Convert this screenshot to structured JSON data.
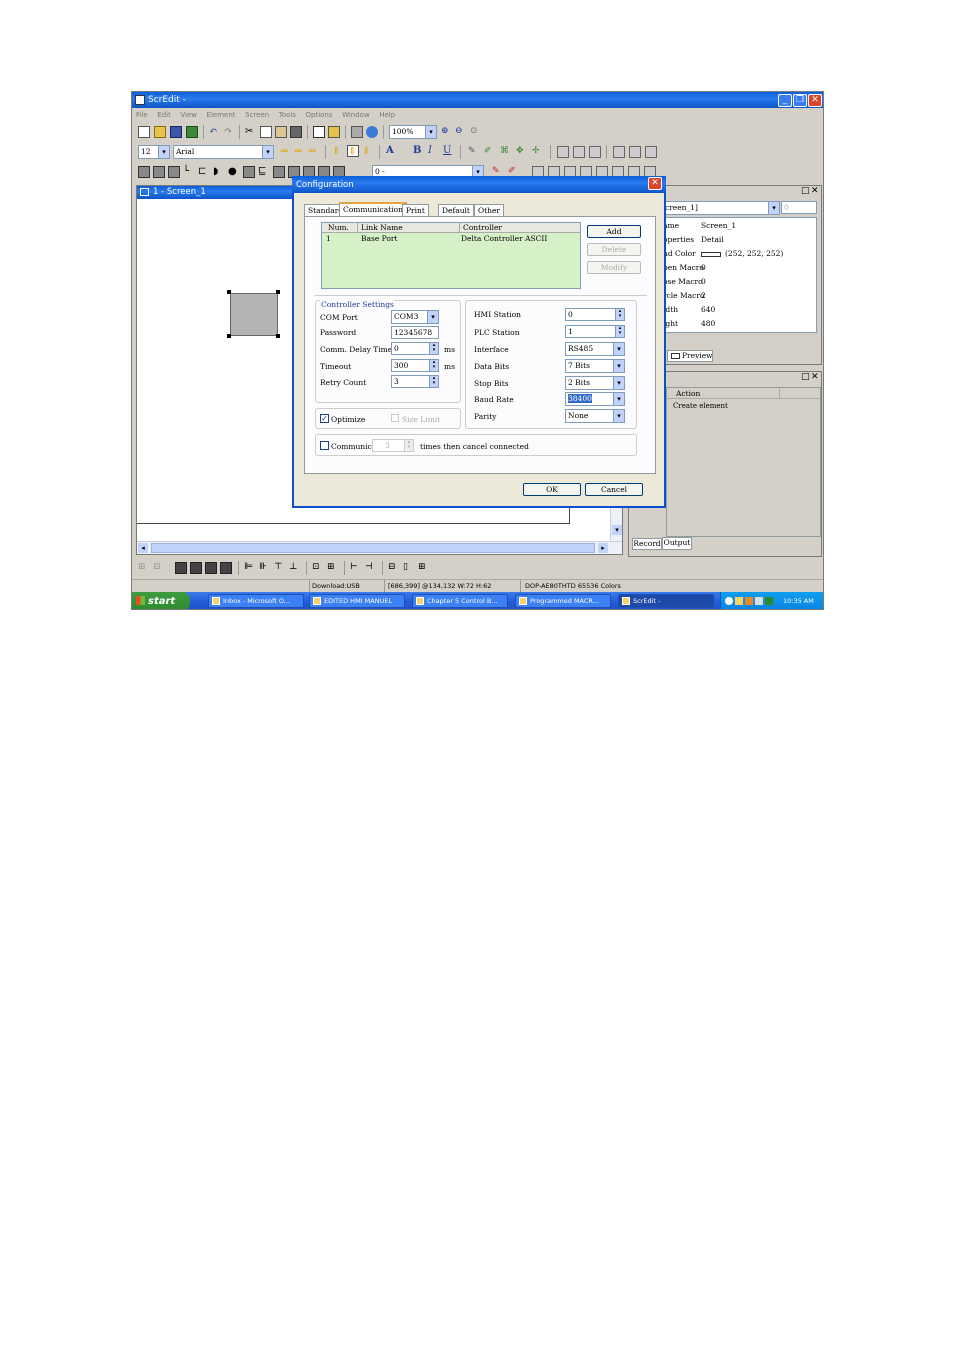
{
  "window": {
    "title": "ScrEdit -"
  },
  "menu": [
    "File",
    "Edit",
    "View",
    "Element",
    "Screen",
    "Tools",
    "Options",
    "Window",
    "Help"
  ],
  "toolbar": {
    "zoom": "100%",
    "font_size": "12",
    "font_name": "Arial",
    "layer": "0 -"
  },
  "screen_panel": {
    "title": "1 - Screen_1"
  },
  "properties_panel": {
    "selector": "creen_1]",
    "rows": [
      {
        "label": "ame",
        "value": "Screen_1"
      },
      {
        "label": "operties",
        "value": "Detail"
      },
      {
        "label": "nd Color",
        "value": "(252, 252, 252)"
      },
      {
        "label": "pen Macro",
        "value": "0"
      },
      {
        "label": "ose Macro",
        "value": "0"
      },
      {
        "label": "rcle Macro",
        "value": "2"
      },
      {
        "label": "idth",
        "value": "640"
      },
      {
        "label": "ight",
        "value": "480"
      }
    ],
    "preview_tab": "Preview"
  },
  "output_panel": {
    "col_action": "Action",
    "row1": "Create element",
    "tabs": [
      "Record",
      "Output"
    ]
  },
  "dialog": {
    "title": "Configuration",
    "tabs": [
      "Standard",
      "Communication",
      "Print",
      "Default",
      "Other"
    ],
    "link_table": {
      "headers": [
        "Num.",
        "Link Name",
        "Controller"
      ],
      "rows": [
        [
          "1",
          "Base Port",
          "Delta Controller ASCII"
        ]
      ]
    },
    "buttons": {
      "add": "Add",
      "delete": "Delete",
      "modify": "Modify",
      "ok": "OK",
      "cancel": "Cancel"
    },
    "controller_settings": {
      "group_title": "Controller Settings",
      "com_port_label": "COM Port",
      "com_port": "COM3",
      "password_label": "Password",
      "password": "12345678",
      "delay_label": "Comm. Delay Time",
      "delay": "0",
      "delay_unit": "ms",
      "timeout_label": "Timeout",
      "timeout": "300",
      "timeout_unit": "ms",
      "retry_label": "Retry Count",
      "retry": "3",
      "optimize_label": "Optimize",
      "size_limit_label": "Size Limit",
      "hmi_station_label": "HMI Station",
      "hmi_station": "0",
      "plc_station_label": "PLC Station",
      "plc_station": "1",
      "interface_label": "Interface",
      "interface": "RS485",
      "data_bits_label": "Data Bits",
      "data_bits": "7 Bits",
      "stop_bits_label": "Stop Bits",
      "stop_bits": "2 Bits",
      "baud_rate_label": "Baud Rate",
      "baud_rate": "38400",
      "parity_label": "Parity",
      "parity": "None"
    },
    "comm_fail": {
      "label": "Communicat",
      "value": "3",
      "suffix": "times then cancel connected"
    }
  },
  "statusbar": {
    "download": "Download:USB",
    "coords": "[686,399] @134,132 W:72 H:62",
    "model": "DOP-AE80THTD 65536 Colors"
  },
  "taskbar": {
    "start": "start",
    "items": [
      "Inbox - Microsoft O...",
      "EDITED HMI MANUEL",
      "Chapter 5 Control B...",
      "Programmed MACR...",
      "ScrEdit -"
    ],
    "clock": "10:35 AM"
  }
}
